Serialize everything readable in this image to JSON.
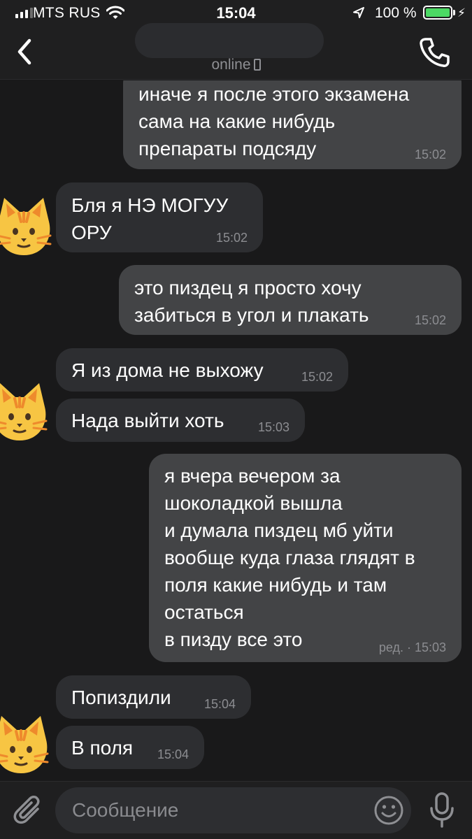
{
  "status_bar": {
    "carrier": "MTS RUS",
    "time": "15:04",
    "battery": "100 %",
    "battery_level": 1.0,
    "battery_color": "#4cd964"
  },
  "header": {
    "status": "online",
    "back_icon": "chevron-left-icon",
    "call_icon": "phone-icon"
  },
  "messages": [
    {
      "dir": "out",
      "text": "иначе я после этого экзамена\nсама на какие нибудь\nпрепараты подсяду",
      "time": "15:02"
    },
    {
      "dir": "in",
      "text": "Бля я НЭ МОГУУ\nОРУ",
      "time": "15:02"
    },
    {
      "dir": "out",
      "text": "это пиздец я просто хочу\nзабиться в угол и плакать",
      "time": "15:02"
    },
    {
      "dir": "in",
      "text": "Я из дома не выхожу",
      "time": "15:02"
    },
    {
      "dir": "in",
      "text": "Нада выйти хоть",
      "time": "15:03"
    },
    {
      "dir": "out",
      "text": "я вчера вечером за\nшоколадкой вышла\nи думала пиздец мб уйти\nвообще куда глаза глядят в\nполя какие нибудь и там\nостаться\nв пизду все это",
      "time": "ред. · 15:03"
    },
    {
      "dir": "in",
      "text": "Попиздили",
      "time": "15:04"
    },
    {
      "dir": "in",
      "text": "В поля",
      "time": "15:04"
    }
  ],
  "composer": {
    "placeholder": "Сообщение",
    "attach_icon": "paperclip-icon",
    "emoji_icon": "smiley-icon",
    "mic_icon": "microphone-icon"
  },
  "colors": {
    "background": "#19191a",
    "bar": "#1f1f20",
    "incoming_bubble": "#2d2e31",
    "outgoing_bubble": "#434446",
    "cat_face": "#f7c543",
    "cat_stripe": "#ee8a2c"
  }
}
